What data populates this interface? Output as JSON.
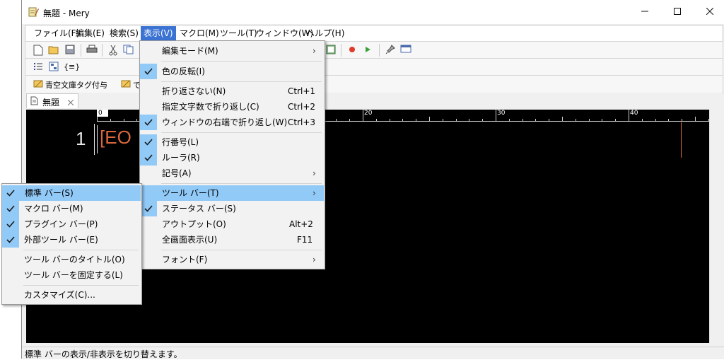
{
  "window": {
    "title": "無題 - Mery"
  },
  "menubar": {
    "items": [
      "ファイル(F)",
      "編集(E)",
      "検索(S)",
      "表示(V)",
      "マクロ(M)",
      "ツール(T)",
      "ウィンドウ(W)",
      "ヘルプ(H)"
    ],
    "active_index": 3
  },
  "toolbar3": {
    "items": [
      "青空文庫タグ付与",
      "で"
    ]
  },
  "tab": {
    "label": "無題"
  },
  "editor": {
    "line_number": "1",
    "eof_text": "[EO",
    "ruler_labels": [
      "0",
      "20",
      "30",
      "40"
    ]
  },
  "view_menu": {
    "items": [
      {
        "label": "編集モード(M)",
        "shortcut": "",
        "checked": false,
        "submenu": true
      },
      {
        "label": "色の反転(I)",
        "shortcut": "",
        "checked": true,
        "submenu": false
      },
      {
        "label": "折り返さない(N)",
        "shortcut": "Ctrl+1",
        "checked": false,
        "submenu": false
      },
      {
        "label": "指定文字数で折り返し(C)",
        "shortcut": "Ctrl+2",
        "checked": false,
        "submenu": false
      },
      {
        "label": "ウィンドウの右端で折り返し(W)",
        "shortcut": "Ctrl+3",
        "checked": true,
        "submenu": false
      },
      {
        "label": "行番号(L)",
        "shortcut": "",
        "checked": true,
        "submenu": false
      },
      {
        "label": "ルーラ(R)",
        "shortcut": "",
        "checked": true,
        "submenu": false
      },
      {
        "label": "記号(A)",
        "shortcut": "",
        "checked": false,
        "submenu": true
      },
      {
        "label": "ツール バー(T)",
        "shortcut": "",
        "checked": false,
        "submenu": true,
        "highlighted": true
      },
      {
        "label": "ステータス バー(S)",
        "shortcut": "",
        "checked": true,
        "submenu": false
      },
      {
        "label": "アウトプット(O)",
        "shortcut": "Alt+2",
        "checked": false,
        "submenu": false
      },
      {
        "label": "全画面表示(U)",
        "shortcut": "F11",
        "checked": false,
        "submenu": false
      },
      {
        "label": "フォント(F)",
        "shortcut": "",
        "checked": false,
        "submenu": true
      }
    ]
  },
  "toolbar_submenu": {
    "items": [
      {
        "label": "標準 バー(S)",
        "checked": true,
        "highlighted": true
      },
      {
        "label": "マクロ バー(M)",
        "checked": true
      },
      {
        "label": "プラグイン バー(P)",
        "checked": true
      },
      {
        "label": "外部ツール バー(E)",
        "checked": true
      },
      {
        "label": "ツール バーのタイトル(O)",
        "checked": false
      },
      {
        "label": "ツール バーを固定する(L)",
        "checked": false
      },
      {
        "label": "カスタマイズ(C)...",
        "checked": false
      }
    ]
  },
  "statusbar": {
    "text": "標準 バーの表示/非表示を切り替えます。"
  },
  "colors": {
    "accent": "#3b73d3",
    "menu_highlight": "#91c9f7",
    "eof": "#d9673e",
    "editor_bg": "#000000"
  },
  "icons": [
    "notepad-icon",
    "new-file-icon",
    "open-folder-icon",
    "save-icon",
    "print-icon",
    "cut-icon",
    "copy-icon",
    "record-icon",
    "play-icon",
    "pin-icon",
    "window-icon",
    "list-icon",
    "outline-icon",
    "brace-icon",
    "document-icon",
    "close-icon",
    "checkmark-icon",
    "chevron-right-icon"
  ]
}
